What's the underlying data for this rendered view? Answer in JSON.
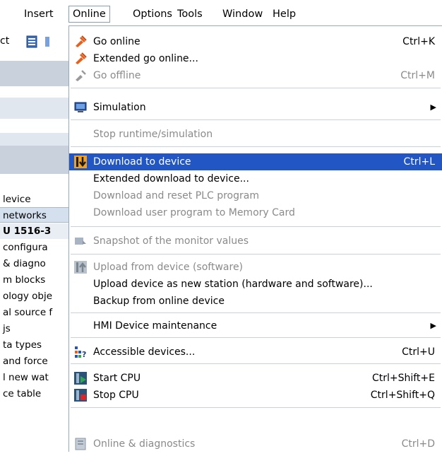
{
  "menubar": {
    "items": [
      {
        "label": "Insert"
      },
      {
        "label": "Online"
      },
      {
        "label": "Options"
      },
      {
        "label": "Tools"
      },
      {
        "label": "Window"
      },
      {
        "label": "Help"
      }
    ]
  },
  "toolbar": {
    "fragment_label": "ct"
  },
  "tree": {
    "rows": [
      "levice",
      "networks",
      "U 1516-3",
      "configura",
      "& diagno",
      "m blocks",
      "ology obje",
      "al source f",
      "js",
      "ta types",
      "and force",
      "l new wat",
      "ce table"
    ]
  },
  "menu": {
    "go_online": {
      "label": "Go online",
      "shortcut": "Ctrl+K"
    },
    "extended_go_online": {
      "label": "Extended go online..."
    },
    "go_offline": {
      "label": "Go offline",
      "shortcut": "Ctrl+M"
    },
    "simulation": {
      "label": "Simulation",
      "arrow": "▶"
    },
    "stop_runtime": {
      "label": "Stop runtime/simulation"
    },
    "download_to_device": {
      "label": "Download to device",
      "shortcut": "Ctrl+L"
    },
    "extended_download": {
      "label": "Extended download to device..."
    },
    "download_reset": {
      "label": "Download and reset PLC program"
    },
    "download_memory_card": {
      "label": "Download user program to Memory Card"
    },
    "snapshot": {
      "label": "Snapshot of the monitor values"
    },
    "upload_from_device": {
      "label": "Upload from device (software)"
    },
    "upload_new_station": {
      "label": "Upload device as new station (hardware and software)..."
    },
    "backup": {
      "label": "Backup from online device"
    },
    "hmi_maintenance": {
      "label": "HMI Device maintenance",
      "arrow": "▶"
    },
    "accessible_devices": {
      "label": "Accessible devices...",
      "shortcut": "Ctrl+U"
    },
    "start_cpu": {
      "label": "Start CPU",
      "shortcut": "Ctrl+Shift+E"
    },
    "stop_cpu": {
      "label": "Stop CPU",
      "shortcut": "Ctrl+Shift+Q"
    },
    "online_diagnostics": {
      "label": "Online & diagnostics",
      "shortcut": "Ctrl+D"
    }
  },
  "colors": {
    "selection": "#2156c4",
    "disabled_text": "#8a8a8a",
    "go_online_icon": "#e8601c",
    "start_green": "#2fa84f",
    "stop_red": "#d9262b"
  }
}
